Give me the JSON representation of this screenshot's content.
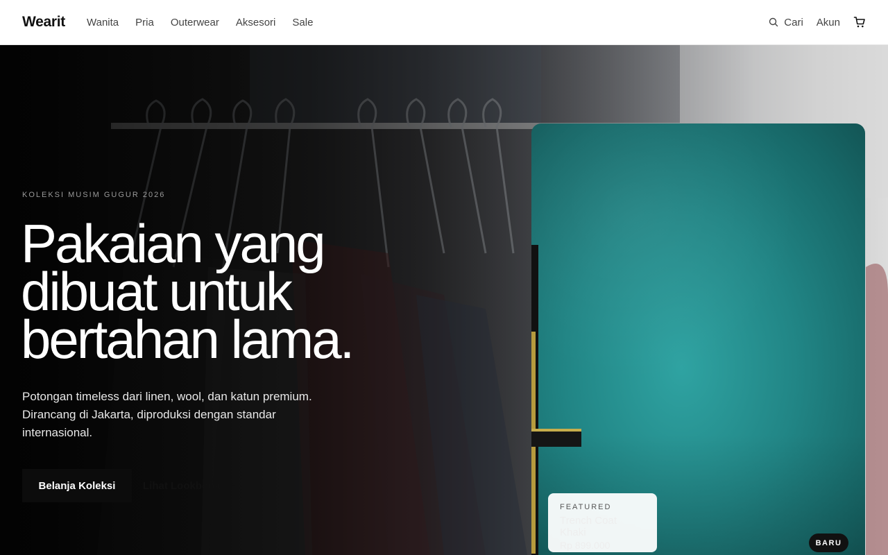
{
  "brand": {
    "name": "Wearit"
  },
  "nav": {
    "links": [
      "Wanita",
      "Pria",
      "Outerwear",
      "Aksesori",
      "Sale"
    ],
    "search_label": "Cari",
    "account_label": "Akun",
    "icons": {
      "search": "search-icon",
      "cart": "cart-icon"
    }
  },
  "hero": {
    "eyebrow": "KOLEKSI MUSIM GUGUR 2026",
    "headline": "Pakaian yang dibuat untuk bertahan lama.",
    "subtext": "Potongan timeless dari linen, wool, dan katun premium. Dirancang di Jakarta, diproduksi dengan standar internasional.",
    "primary_cta": "Belanja Koleksi",
    "secondary_cta": "Lihat Lookbook",
    "secondary_cta_icon": "arrow-right-icon"
  },
  "feature": {
    "label": "FEATURED",
    "name": "Trench Coat Khaki",
    "price": "Rp 899.000",
    "badge": "BARU"
  },
  "colors": {
    "accent_dark": "#0c0c0c",
    "card_teal": "#218585",
    "nav_bg": "#ffffff"
  }
}
